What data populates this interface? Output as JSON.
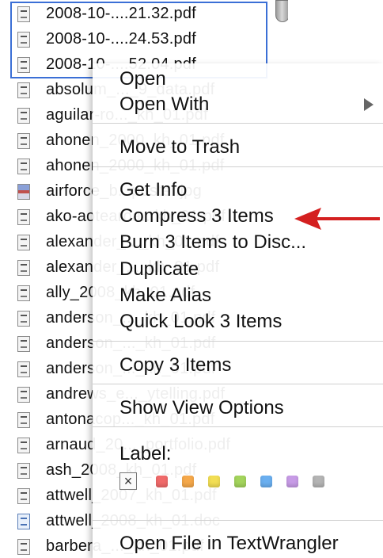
{
  "files": [
    {
      "name": "2008-10-....21.32.pdf",
      "icon": "pdf-icon"
    },
    {
      "name": "2008-10-....24.53.pdf",
      "icon": "pdf-icon"
    },
    {
      "name": "2008-10-....52.04.pdf",
      "icon": "pdf-icon"
    },
    {
      "name": "absolum_..._9_data.pdf",
      "icon": "pdf-icon"
    },
    {
      "name": "aguilar-ro..._kh_01.pdf",
      "icon": "pdf-icon"
    },
    {
      "name": "ahonen_2000_kh_01.pdf",
      "icon": "pdf-icon"
    },
    {
      "name": "ahonen_2000_kh_01.pdf",
      "icon": "pdf-icon"
    },
    {
      "name": "airforce_b...poster.jpg",
      "icon": "image-icon"
    },
    {
      "name": "ako-aotearoa...kh_01.pdf",
      "icon": "pdf-icon"
    },
    {
      "name": "alexander_..._kh_01.pdf",
      "icon": "pdf-icon"
    },
    {
      "name": "alexander_..._kh_01.pdf",
      "icon": "pdf-icon"
    },
    {
      "name": "ally_2008_kh_01.pdf",
      "icon": "pdf-icon"
    },
    {
      "name": "anderson_..._kh_01.pdf",
      "icon": "pdf-icon"
    },
    {
      "name": "anderson_..._kh_01.pdf",
      "icon": "pdf-icon"
    },
    {
      "name": "anderson_..._kh_01.pdf",
      "icon": "pdf-icon"
    },
    {
      "name": "andrews_e..._ytelling.pdf",
      "icon": "pdf-icon"
    },
    {
      "name": "antonacop..._kh_01.pdf",
      "icon": "pdf-icon"
    },
    {
      "name": "arnaud_20..._portfolio.pdf",
      "icon": "pdf-icon"
    },
    {
      "name": "ash_2008_kh_01.pdf",
      "icon": "pdf-icon"
    },
    {
      "name": "attwell_2007_kh_01.pdf",
      "icon": "pdf-icon"
    },
    {
      "name": "attwell_2008_kh_01.doc",
      "icon": "doc-icon"
    },
    {
      "name": "barbera_..._kh_01.pdf",
      "icon": "pdf-icon"
    }
  ],
  "menu": {
    "open": "Open",
    "open_with": "Open With",
    "move_to_trash": "Move to Trash",
    "get_info": "Get Info",
    "compress": "Compress 3 Items",
    "burn": "Burn 3 Items to Disc...",
    "duplicate": "Duplicate",
    "make_alias": "Make Alias",
    "quick_look": "Quick Look 3 Items",
    "copy": "Copy 3 Items",
    "show_view_options": "Show View Options",
    "label": "Label:",
    "label_none_symbol": "×",
    "open_textwrangler": "Open File in TextWrangler"
  },
  "label_colors": [
    "#f06a6a",
    "#f5a84a",
    "#f2de54",
    "#a3d45c",
    "#6aaff0",
    "#c79be6",
    "#b4b4b4"
  ],
  "annotation_color": "#d42020"
}
